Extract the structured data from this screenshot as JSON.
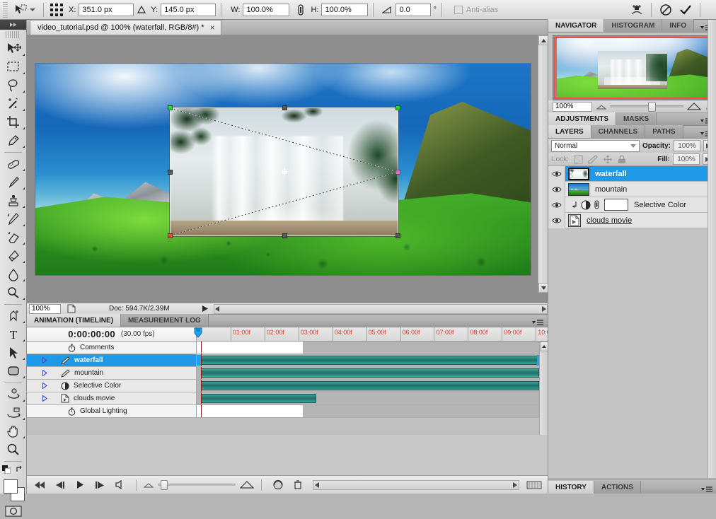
{
  "options_bar": {
    "tool_preset_name": "move-tool-preset",
    "fields": [
      {
        "label": "X:",
        "value": "351.0 px",
        "name": "x-position-field"
      },
      {
        "label": "Y:",
        "value": "145.0 px",
        "name": "y-position-field"
      },
      {
        "label": "W:",
        "value": "100.0%",
        "name": "width-field"
      },
      {
        "label": "H:",
        "value": "100.0%",
        "name": "height-field"
      },
      {
        "label": "",
        "value": "0.0",
        "name": "rotation-field"
      }
    ],
    "degree_symbol": "°",
    "antialias_label": "Anti-alias",
    "warp_icon": "warp-icon",
    "cancel_icon": "cancel-transform-icon",
    "commit_icon": "commit-transform-icon"
  },
  "toolbox": {
    "tools": [
      {
        "name": "move-tool",
        "selected": false
      },
      {
        "name": "rectangular-marquee-tool",
        "selected": false
      },
      {
        "name": "lasso-tool",
        "selected": false
      },
      {
        "name": "magic-wand-tool",
        "selected": false
      },
      {
        "name": "crop-tool",
        "selected": false
      },
      {
        "name": "eyedropper-tool",
        "selected": false
      },
      {
        "name": "healing-brush-tool",
        "selected": false
      },
      {
        "name": "brush-tool",
        "selected": false
      },
      {
        "name": "clone-stamp-tool",
        "selected": false
      },
      {
        "name": "history-brush-tool",
        "selected": false
      },
      {
        "name": "eraser-tool",
        "selected": false
      },
      {
        "name": "gradient-tool",
        "selected": false
      },
      {
        "name": "blur-tool",
        "selected": false
      },
      {
        "name": "dodge-tool",
        "selected": false
      },
      {
        "name": "pen-tool",
        "selected": false
      },
      {
        "name": "type-tool",
        "selected": false
      },
      {
        "name": "path-selection-tool",
        "selected": false
      },
      {
        "name": "rounded-rectangle-tool",
        "selected": false
      },
      {
        "name": "rotate-3d-object-tool",
        "selected": false
      },
      {
        "name": "rotate-3d-camera-tool",
        "selected": false
      },
      {
        "name": "hand-tool",
        "selected": false
      },
      {
        "name": "zoom-tool",
        "selected": false
      }
    ],
    "foreground_color": "#ffffff",
    "background_color": "#ffffff",
    "quick_mask_icon": "quick-mask-icon"
  },
  "document": {
    "tab_title": "video_tutorial.psd @ 100% (waterfall, RGB/8#) *",
    "close_label": "×"
  },
  "status_bar": {
    "zoom": "100%",
    "doc_info": "Doc: 594.7K/2.39M"
  },
  "navigator": {
    "tabs": [
      {
        "label": "NAVIGATOR",
        "active": true
      },
      {
        "label": "HISTOGRAM",
        "active": false
      },
      {
        "label": "INFO",
        "active": false
      }
    ],
    "zoom_value": "100%",
    "view_box_color": "#ff4a3a"
  },
  "adjustments": {
    "tabs": [
      {
        "label": "ADJUSTMENTS",
        "active": true
      },
      {
        "label": "MASKS",
        "active": false
      }
    ]
  },
  "layers_panel": {
    "tabs": [
      {
        "label": "LAYERS",
        "active": true
      },
      {
        "label": "CHANNELS",
        "active": false
      },
      {
        "label": "PATHS",
        "active": false
      }
    ],
    "blend_mode": "Normal",
    "opacity_label": "Opacity:",
    "opacity_value": "100%",
    "fill_label": "Fill:",
    "fill_value": "100%",
    "lock_label": "Lock:",
    "lock_icons": [
      "lock-transparency-icon",
      "lock-image-icon",
      "lock-position-icon",
      "lock-all-icon"
    ],
    "layers": [
      {
        "name": "waterfall",
        "type": "pixel",
        "selected": true,
        "visible": true
      },
      {
        "name": "mountain",
        "type": "pixel",
        "selected": false,
        "visible": true
      },
      {
        "name": "Selective Color",
        "type": "adjustment",
        "selected": false,
        "visible": true
      },
      {
        "name": "clouds movie",
        "type": "video",
        "selected": false,
        "visible": true,
        "underlined": true
      }
    ],
    "footer_icons": [
      "link-layers-icon",
      "layer-style-icon",
      "layer-mask-icon",
      "new-adjustment-layer-icon",
      "new-group-icon",
      "new-layer-icon",
      "delete-layer-icon"
    ],
    "selected_accent": "#1f9ae8"
  },
  "history_panel": {
    "tabs": [
      {
        "label": "HISTORY",
        "active": true
      },
      {
        "label": "ACTIONS",
        "active": false
      }
    ]
  },
  "animation_panel": {
    "tabs": [
      {
        "label": "ANIMATION (TIMELINE)",
        "active": true
      },
      {
        "label": "MEASUREMENT LOG",
        "active": false
      }
    ],
    "timecode": "0:00:00:00",
    "fps": "(30.00 fps)",
    "ruler_labels": [
      "01:00f",
      "02:00f",
      "03:00f",
      "04:00f",
      "05:00f",
      "06:00f",
      "07:00f",
      "08:00f",
      "09:00f",
      "10:0"
    ],
    "tracks": [
      {
        "name": "Comments",
        "kind": "comments",
        "selected": false,
        "bar": false
      },
      {
        "name": "waterfall",
        "kind": "layer",
        "selected": true,
        "bar": true,
        "bar_span": 100
      },
      {
        "name": "mountain",
        "kind": "layer",
        "selected": false,
        "bar": true,
        "bar_span": 100
      },
      {
        "name": "Selective Color",
        "kind": "adjustment",
        "selected": false,
        "bar": true,
        "bar_span": 100
      },
      {
        "name": "clouds movie",
        "kind": "video",
        "selected": false,
        "bar": true,
        "bar_span": 35
      },
      {
        "name": "Global Lighting",
        "kind": "global",
        "selected": false,
        "bar": false
      }
    ],
    "playback_buttons": [
      "go-to-first-frame-button",
      "select-previous-frame-button",
      "play-button",
      "select-next-frame-button",
      "audio-button"
    ],
    "extra_buttons": [
      "onion-skin-button",
      "delete-keyframes-button"
    ],
    "bar_color": "#2f8c84",
    "playhead_color": "#8b1d1d"
  }
}
